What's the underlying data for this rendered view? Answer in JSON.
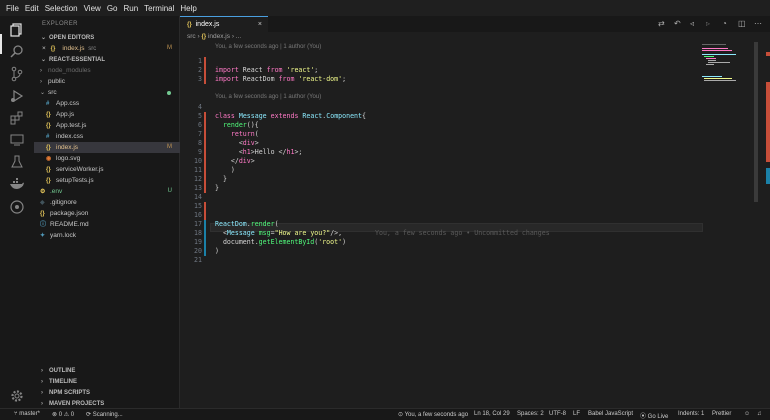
{
  "menubar": [
    "File",
    "Edit",
    "Selection",
    "View",
    "Go",
    "Run",
    "Terminal",
    "Help"
  ],
  "sidebar": {
    "title": "EXPLORER",
    "open_editors_label": "OPEN EDITORS",
    "open_editor": {
      "close": "×",
      "icon": "{}",
      "name": "index.js",
      "folder": "src",
      "badge": "M"
    },
    "project_label": "REACT-ESSENTIAL",
    "tree": [
      {
        "chev": "›",
        "icon": "",
        "name": "node_modules",
        "indent": 1,
        "color": "#6b6b6b"
      },
      {
        "chev": "›",
        "icon": "",
        "name": "public",
        "indent": 1,
        "color": "#c8c8c8"
      },
      {
        "chev": "⌄",
        "icon": "",
        "name": "src",
        "indent": 1,
        "color": "#c8c8c8",
        "dot": true
      },
      {
        "chev": "",
        "icon": "#",
        "name": "App.css",
        "indent": 2,
        "color": "#c8c8c8",
        "iconColor": "#519aba"
      },
      {
        "chev": "",
        "icon": "{}",
        "name": "App.js",
        "indent": 2,
        "color": "#c8c8c8",
        "iconColor": "#e8c95c"
      },
      {
        "chev": "",
        "icon": "{}",
        "name": "App.test.js",
        "indent": 2,
        "color": "#c8c8c8",
        "iconColor": "#e8c95c"
      },
      {
        "chev": "",
        "icon": "#",
        "name": "index.css",
        "indent": 2,
        "color": "#c8c8c8",
        "iconColor": "#519aba"
      },
      {
        "chev": "",
        "icon": "{}",
        "name": "index.js",
        "indent": 2,
        "color": "#e2c08d",
        "iconColor": "#e8c95c",
        "badge": "M",
        "selected": true
      },
      {
        "chev": "",
        "icon": "◉",
        "name": "logo.svg",
        "indent": 2,
        "color": "#c8c8c8",
        "iconColor": "#e37933"
      },
      {
        "chev": "",
        "icon": "{}",
        "name": "serviceWorker.js",
        "indent": 2,
        "color": "#c8c8c8",
        "iconColor": "#e8c95c"
      },
      {
        "chev": "",
        "icon": "{}",
        "name": "setupTests.js",
        "indent": 2,
        "color": "#c8c8c8",
        "iconColor": "#e8c95c"
      },
      {
        "chev": "",
        "icon": "⚙",
        "name": ".env",
        "indent": 1,
        "color": "#73c991",
        "iconColor": "#e8c95c",
        "badge": "U"
      },
      {
        "chev": "",
        "icon": "◆",
        "name": ".gitignore",
        "indent": 1,
        "color": "#c8c8c8",
        "iconColor": "#41535b"
      },
      {
        "chev": "",
        "icon": "{}",
        "name": "package.json",
        "indent": 1,
        "color": "#c8c8c8",
        "iconColor": "#e8c95c"
      },
      {
        "chev": "",
        "icon": "ⓘ",
        "name": "README.md",
        "indent": 1,
        "color": "#c8c8c8",
        "iconColor": "#519aba"
      },
      {
        "chev": "",
        "icon": "✦",
        "name": "yarn.lock",
        "indent": 1,
        "color": "#c8c8c8",
        "iconColor": "#519aba"
      }
    ],
    "bottom_sections": [
      "OUTLINE",
      "TIMELINE",
      "NPM SCRIPTS",
      "MAVEN PROJECTS"
    ]
  },
  "editor": {
    "tab": {
      "icon": "{}",
      "name": "index.js",
      "close": "×"
    },
    "breadcrumb": {
      "folder": "src",
      "sep": "›",
      "icon": "{}",
      "file": "index.js",
      "more": "› ..."
    },
    "codelens_1": "You, a few seconds ago | 1 author (You)",
    "codelens_2": "You, a few seconds ago | 1 author (You)",
    "ghost_text": "You, a few seconds ago • Uncommitted changes",
    "lines": [
      {
        "n": "1",
        "html": ""
      },
      {
        "n": "2",
        "html": "<span class='kw'>import</span> React <span class='kw'>from</span> <span class='str'>'react'</span>;"
      },
      {
        "n": "3",
        "html": "<span class='kw'>import</span> ReactDom <span class='kw'>from</span> <span class='str'>'react-dom'</span>;"
      },
      {
        "n": "4",
        "html": ""
      },
      {
        "n": "5",
        "html": "<span class='kw'>class</span> <span class='cls'>Message</span> <span class='kw'>extends</span> <span class='cls'>React</span>.<span class='cls'>Component</span>{"
      },
      {
        "n": "6",
        "html": "  <span class='fn'>render</span>(){"
      },
      {
        "n": "7",
        "html": "    <span class='kw'>return</span>("
      },
      {
        "n": "8",
        "html": "      &lt;<span class='tag'>div</span>&gt;"
      },
      {
        "n": "9",
        "html": "      &lt;<span class='tag'>h1</span>&gt;Hello &lt;/<span class='tag'>h1</span>&gt;;"
      },
      {
        "n": "10",
        "html": "    &lt;/<span class='tag'>div</span>&gt;"
      },
      {
        "n": "11",
        "html": "    )"
      },
      {
        "n": "12",
        "html": "  }"
      },
      {
        "n": "13",
        "html": "}"
      },
      {
        "n": "14",
        "html": ""
      },
      {
        "n": "15",
        "html": ""
      },
      {
        "n": "16",
        "html": ""
      },
      {
        "n": "17",
        "html": "<span class='cls'>ReactDom</span>.<span class='fn'>render</span>("
      },
      {
        "n": "18",
        "html": "  &lt;<span class='cls'>Message</span> <span class='fn'>msg</span>=<span class='str'>\"How are you?\"</span>/&gt;,"
      },
      {
        "n": "19",
        "html": "  document.<span class='fn'>getElementById</span>(<span class='str'>'root'</span>)"
      },
      {
        "n": "20",
        "html": ")"
      },
      {
        "n": "21",
        "html": ""
      }
    ]
  },
  "statusbar": {
    "branch": "master*",
    "problems": "⊗ 0 ⚠ 0",
    "scanning": "Scanning...",
    "blame": "You, a few seconds ago",
    "position": "Ln 18, Col 29",
    "spaces": "Spaces: 2",
    "encoding": "UTF-8",
    "eol": "LF",
    "language": "Babel JavaScript",
    "golive": "Go Live",
    "indents": "Indents: 1",
    "prettier": "Prettier",
    "accent": "#4a9fe0"
  }
}
